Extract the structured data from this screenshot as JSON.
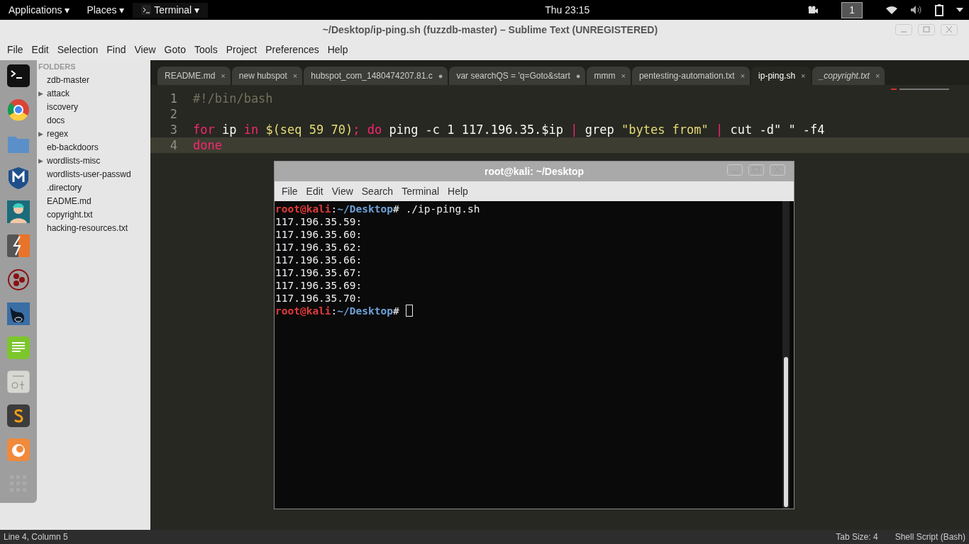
{
  "top_bar": {
    "menus": [
      {
        "label": "Applications",
        "caret": "▾",
        "kind": "menu"
      },
      {
        "label": "Places",
        "caret": "▾",
        "kind": "menu"
      },
      {
        "label": "Terminal",
        "caret": "▾",
        "kind": "app"
      }
    ],
    "clock": "Thu 23:15",
    "workspace": "1"
  },
  "window": {
    "title": "~/Desktop/ip-ping.sh (fuzzdb-master) – Sublime Text (UNREGISTERED)"
  },
  "menu": [
    "File",
    "Edit",
    "Selection",
    "Find",
    "View",
    "Goto",
    "Tools",
    "Project",
    "Preferences",
    "Help"
  ],
  "sidebar": {
    "header": "FOLDERS",
    "items": [
      {
        "label": "zdb-master"
      },
      {
        "label": "attack",
        "arrow": "▶"
      },
      {
        "label": "iscovery"
      },
      {
        "label": "docs"
      },
      {
        "label": "regex",
        "arrow": "▶"
      },
      {
        "label": "eb-backdoors"
      },
      {
        "label": "wordlists-misc",
        "arrow": "▶"
      },
      {
        "label": "wordlists-user-passwd"
      },
      {
        "label": ".directory"
      },
      {
        "label": "EADME.md"
      },
      {
        "label": "copyright.txt"
      },
      {
        "label": "hacking-resources.txt"
      }
    ]
  },
  "tabs": [
    {
      "label": "README.md",
      "marker": "×",
      "selected": false,
      "preview": false
    },
    {
      "label": "new hubspot",
      "marker": "×",
      "selected": false,
      "preview": false
    },
    {
      "label": "hubspot_com_1480474207.81.c",
      "marker": "●",
      "selected": false,
      "preview": false
    },
    {
      "label": "var searchQS = 'q=Goto&start",
      "marker": "●",
      "selected": false,
      "preview": false
    },
    {
      "label": "mmm",
      "marker": "×",
      "selected": false,
      "preview": false
    },
    {
      "label": "pentesting-automation.txt",
      "marker": "×",
      "selected": false,
      "preview": false
    },
    {
      "label": "ip-ping.sh",
      "marker": "×",
      "selected": true,
      "preview": false
    },
    {
      "label": "_copyright.txt",
      "marker": "×",
      "selected": false,
      "preview": true
    }
  ],
  "editor": {
    "lines": [
      {
        "number": "1",
        "current": false,
        "tokens": [
          {
            "kind": "comment",
            "text": "#!/bin/bash"
          }
        ]
      },
      {
        "number": "2",
        "current": false
      },
      {
        "number": "3",
        "current": false,
        "tokens": [
          {
            "kind": "keyword",
            "text": "for"
          },
          {
            "kind": "plain",
            "text": " ip "
          },
          {
            "kind": "keyword",
            "text": "in"
          },
          {
            "kind": "string",
            "text": " $(seq 59 70)"
          },
          {
            "kind": "keyword",
            "text": ";"
          },
          {
            "kind": "keyword",
            "text": " do"
          },
          {
            "kind": "plain",
            "text": " ping -c 1 117.196.35.$ip "
          },
          {
            "kind": "keyword",
            "text": "|"
          },
          {
            "kind": "plain",
            "text": " grep "
          },
          {
            "kind": "string",
            "text": "\"bytes from\""
          },
          {
            "kind": "keyword",
            "text": " |"
          },
          {
            "kind": "plain",
            "text": " cut -d\" \" -f4"
          }
        ]
      },
      {
        "number": "4",
        "current": true,
        "tokens": [
          {
            "kind": "keyword",
            "text": "done"
          }
        ]
      }
    ]
  },
  "terminal": {
    "title": "root@kali: ~/Desktop",
    "menu": [
      "File",
      "Edit",
      "View",
      "Search",
      "Terminal",
      "Help"
    ],
    "lines": [
      {
        "kind": "prompt",
        "user": "root@kali",
        "sep": ":",
        "path": "~/Desktop",
        "hash": "#",
        "command": "./ip-ping.sh",
        "cursor": false
      },
      {
        "kind": "output",
        "text": "117.196.35.59:"
      },
      {
        "kind": "output",
        "text": "117.196.35.60:"
      },
      {
        "kind": "output",
        "text": "117.196.35.62:"
      },
      {
        "kind": "output",
        "text": "117.196.35.66:"
      },
      {
        "kind": "output",
        "text": "117.196.35.67:"
      },
      {
        "kind": "output",
        "text": "117.196.35.69:"
      },
      {
        "kind": "output",
        "text": "117.196.35.70:"
      },
      {
        "kind": "prompt",
        "user": "root@kali",
        "sep": ":",
        "path": "~/Desktop",
        "hash": "#",
        "cursor": true
      }
    ]
  },
  "status_bar": {
    "position": "Line 4, Column 5",
    "tab_size": "Tab Size: 4",
    "syntax": "Shell Script (Bash)"
  }
}
